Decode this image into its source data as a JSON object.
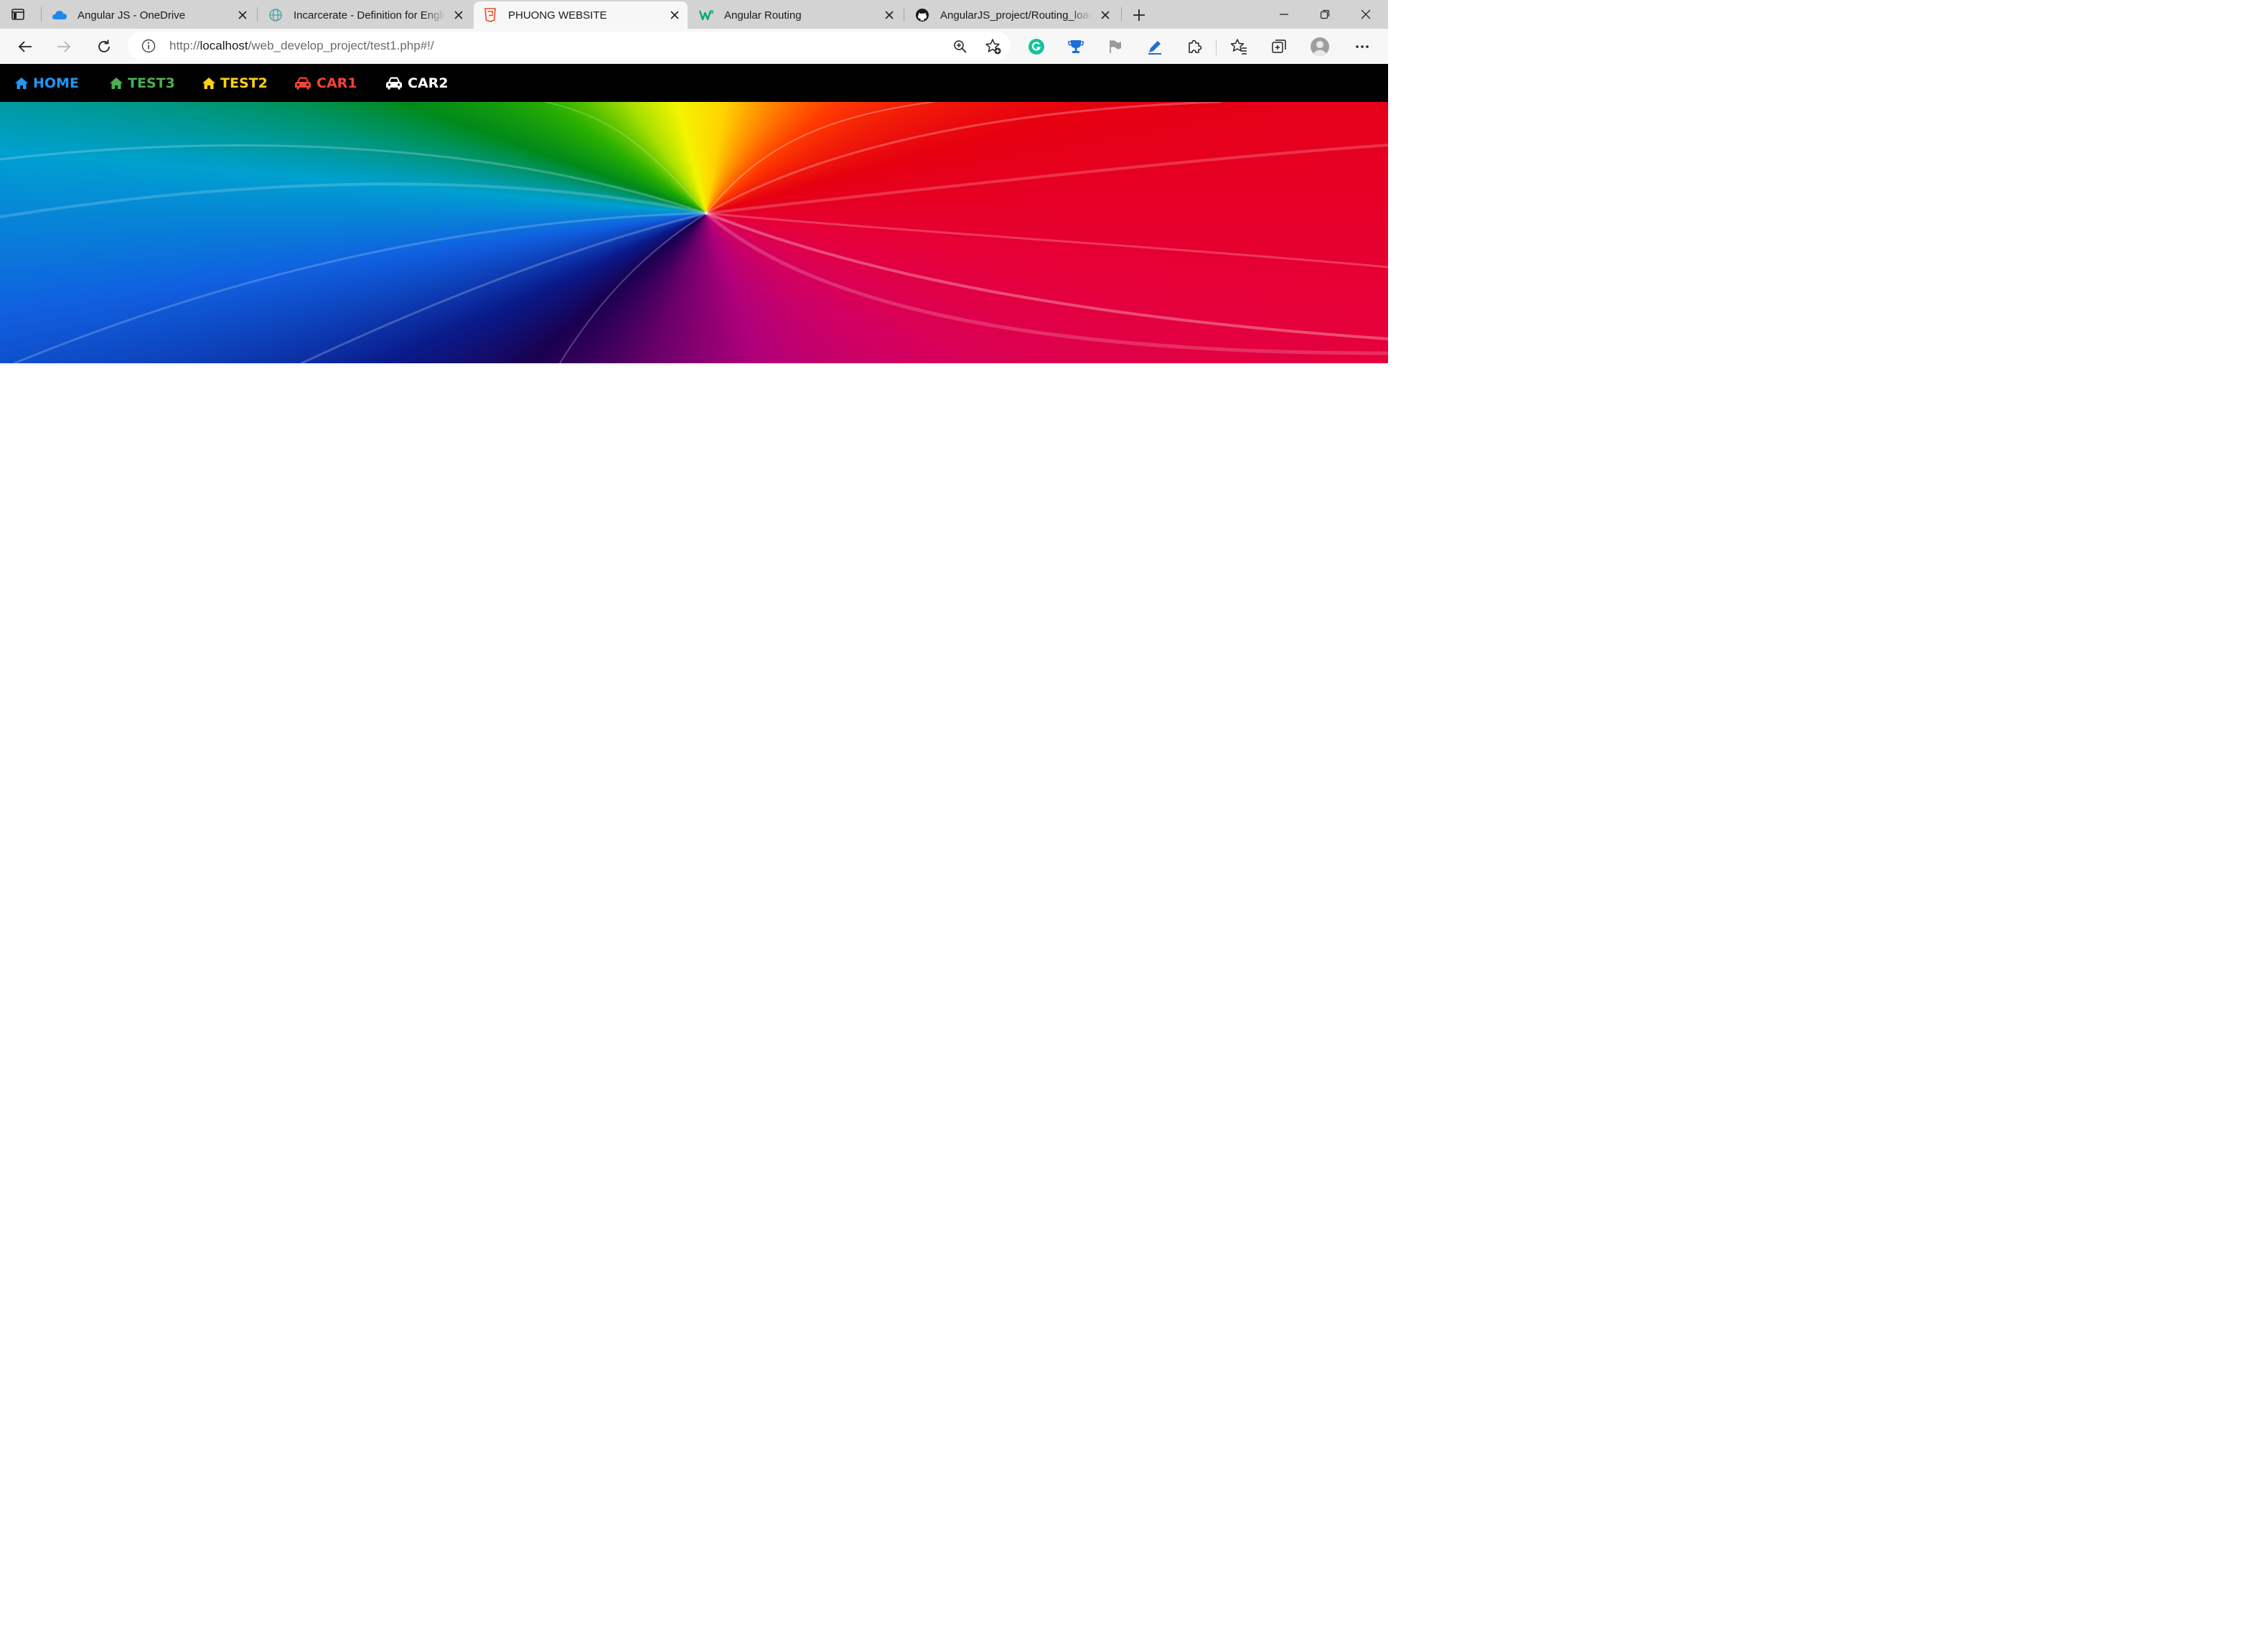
{
  "browser": {
    "tabs": [
      {
        "title": "Angular JS - OneDrive",
        "favicon": "onedrive-cloud-icon",
        "active": false
      },
      {
        "title": "Incarcerate - Definition for Englis",
        "favicon": "globe-icon",
        "active": false
      },
      {
        "title": "PHUONG WEBSITE",
        "favicon": "html5-icon",
        "active": true
      },
      {
        "title": "Angular Routing",
        "favicon": "w3schools-icon",
        "active": false
      },
      {
        "title": "AngularJS_project/Routing_loadi",
        "favicon": "github-icon",
        "active": false
      }
    ],
    "address": {
      "scheme": "http://",
      "host": "localhost",
      "path": "/web_develop_project/test1.php#!/"
    }
  },
  "site": {
    "nav": [
      {
        "label": "HOME",
        "icon": "home-icon",
        "color": "#2196f3"
      },
      {
        "label": "TEST3",
        "icon": "home-icon",
        "color": "#4caf50"
      },
      {
        "label": "TEST2",
        "icon": "home-icon",
        "color": "#ffd11a"
      },
      {
        "label": "CAR1",
        "icon": "car-icon",
        "color": "#f44336"
      },
      {
        "label": "CAR2",
        "icon": "car-icon",
        "color": "#ffffff"
      }
    ],
    "banner": {
      "image": "rainbow-swirl-banner"
    }
  }
}
